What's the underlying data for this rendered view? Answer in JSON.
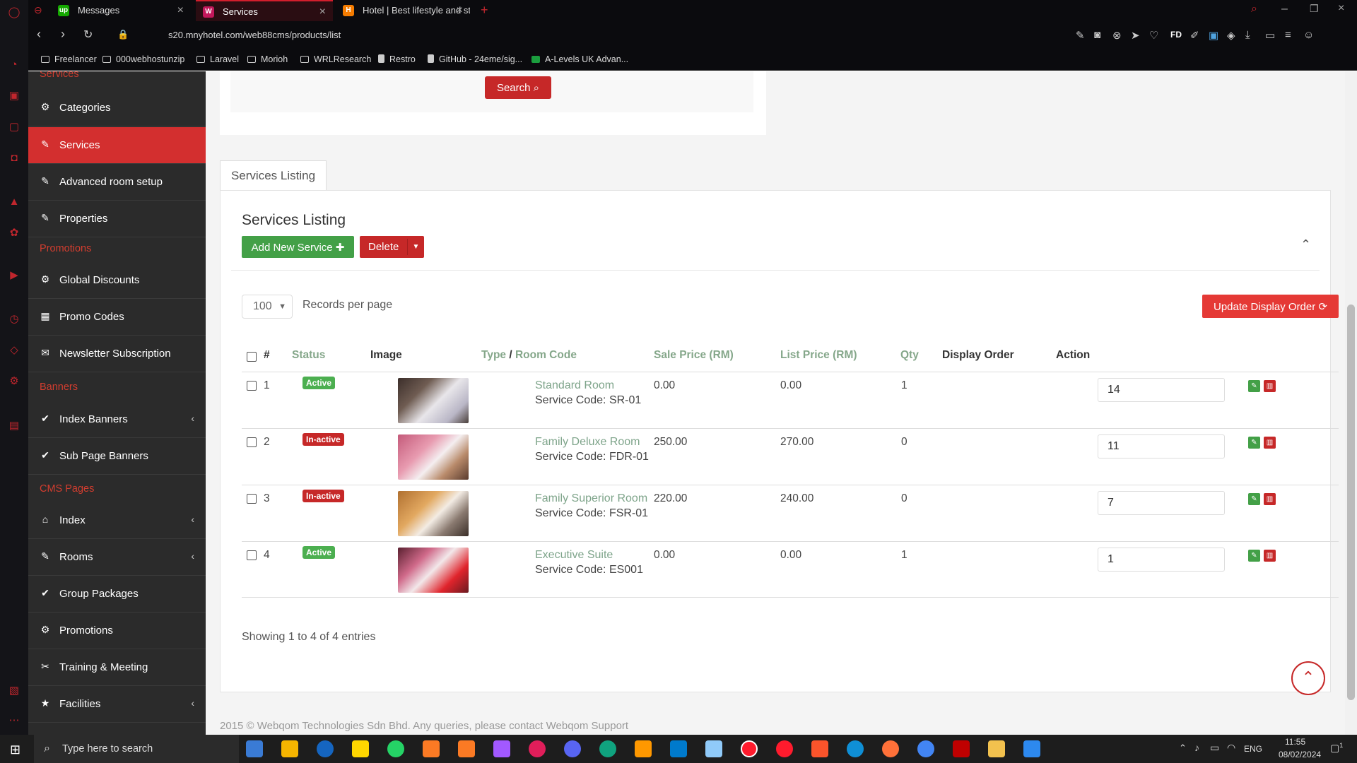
{
  "browser": {
    "tabs": [
      {
        "label": "Messages",
        "favicon": "up"
      },
      {
        "label": "Services",
        "favicon": "W"
      },
      {
        "label": "Hotel | Best lifestyle and st",
        "favicon": "H"
      }
    ],
    "url": "s20.mnyhotel.com/web88cms/products/list",
    "bookmarks": [
      "Freelancer",
      "000webhostunzip",
      "Laravel",
      "Morioh",
      "WRLResearch",
      "Restro",
      "GitHub - 24eme/sig...",
      "A-Levels UK Advan..."
    ],
    "toolbar_text": "FD"
  },
  "sidebar": {
    "sections": {
      "services": "Services",
      "promotions": "Promotions",
      "banners": "Banners",
      "cms": "CMS Pages"
    },
    "items": [
      {
        "label": "Categories",
        "icon": "gear-icon"
      },
      {
        "label": "Services",
        "icon": "wrench-icon"
      },
      {
        "label": "Advanced room setup",
        "icon": "wrench-icon"
      },
      {
        "label": "Properties",
        "icon": "wrench-icon"
      },
      {
        "label": "Global Discounts",
        "icon": "gear-icon"
      },
      {
        "label": "Promo Codes",
        "icon": "table-icon"
      },
      {
        "label": "Newsletter Subscription",
        "icon": "envelope-icon"
      },
      {
        "label": "Index Banners",
        "icon": "check-circle-icon"
      },
      {
        "label": "Sub Page Banners",
        "icon": "check-circle-icon"
      },
      {
        "label": "Index",
        "icon": "home-icon"
      },
      {
        "label": "Rooms",
        "icon": "wrench-icon"
      },
      {
        "label": "Group Packages",
        "icon": "check-circle-icon"
      },
      {
        "label": "Promotions",
        "icon": "gear-icon"
      },
      {
        "label": "Training & Meeting",
        "icon": "cutlery-icon"
      },
      {
        "label": "Facilities",
        "icon": "star-icon"
      }
    ]
  },
  "search": {
    "button_label": "Search"
  },
  "listing": {
    "tab_label": "Services Listing",
    "title": "Services Listing",
    "add_label": "Add New Service",
    "delete_label": "Delete",
    "records_per_page_value": "100",
    "records_per_page_label": "Records per page",
    "update_order_label": "Update Display Order",
    "columns": {
      "index": "#",
      "status": "Status",
      "image": "Image",
      "type": "Type",
      "separator": "/",
      "room_code": "Room Code",
      "sale_price": "Sale Price (RM)",
      "list_price": "List Price (RM)",
      "qty": "Qty",
      "display_order": "Display Order",
      "action": "Action"
    },
    "rows": [
      {
        "index": "1",
        "status": "Active",
        "name": "Standard Room",
        "code": "Service Code: SR-01",
        "sale": "0.00",
        "list": "0.00",
        "qty": "1",
        "order": "14"
      },
      {
        "index": "2",
        "status": "In-active",
        "name": "Family Deluxe Room",
        "code": "Service Code: FDR-01",
        "sale": "250.00",
        "list": "270.00",
        "qty": "0",
        "order": "11"
      },
      {
        "index": "3",
        "status": "In-active",
        "name": "Family Superior Room",
        "code": "Service Code: FSR-01",
        "sale": "220.00",
        "list": "240.00",
        "qty": "0",
        "order": "7"
      },
      {
        "index": "4",
        "status": "Active",
        "name": "Executive Suite",
        "code": "Service Code: ES001",
        "sale": "0.00",
        "list": "0.00",
        "qty": "1",
        "order": "1"
      }
    ],
    "showing": "Showing 1 to 4 of 4 entries"
  },
  "footer": {
    "text": "2015 © Webqom Technologies Sdn Bhd. Any queries, please contact Webqom Support"
  },
  "taskbar": {
    "search_placeholder": "Type here to search",
    "language": "ENG",
    "time": "11:55",
    "date": "08/02/2024",
    "notifications": "1"
  },
  "colors": {
    "accent": "#d32f2f",
    "active_badge": "#4caf50",
    "inactive_badge": "#c62828",
    "link_green": "#7ea48a"
  }
}
